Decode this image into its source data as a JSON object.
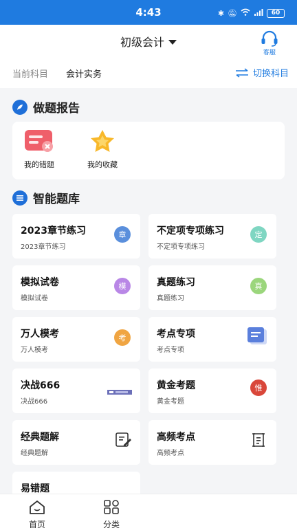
{
  "status_bar": {
    "time": "4:43",
    "battery": "60"
  },
  "header": {
    "subject": "初级会计",
    "service_label": "客服",
    "current_label": "当前科目",
    "current_value": "会计实务",
    "switch_label": "切换科目"
  },
  "report": {
    "title": "做题报告",
    "items": [
      {
        "label": "我的错题"
      },
      {
        "label": "我的收藏"
      }
    ]
  },
  "bank": {
    "title": "智能题库",
    "cards": [
      {
        "title": "2023章节练习",
        "sub": "2023章节练习",
        "badge": "章",
        "badge_color": "#5a8fdc"
      },
      {
        "title": "不定项专项练习",
        "sub": "不定项专项练习",
        "badge": "定",
        "badge_color": "#7fd6c2"
      },
      {
        "title": "模拟试卷",
        "sub": "模拟试卷",
        "badge": "模",
        "badge_color": "#b987e6"
      },
      {
        "title": "真题练习",
        "sub": "真题练习",
        "badge": "真",
        "badge_color": "#9bd67c"
      },
      {
        "title": "万人模考",
        "sub": "万人模考",
        "badge": "考",
        "badge_color": "#f0a542"
      },
      {
        "title": "考点专项",
        "sub": "考点专项",
        "icon": "document-icon"
      },
      {
        "title": "决战666",
        "sub": "决战666",
        "icon": "banner-icon"
      },
      {
        "title": "黄金考题",
        "sub": "黄金考题",
        "badge": "惟",
        "badge_color": "#d9473a"
      },
      {
        "title": "经典题解",
        "sub": "经典题解",
        "icon": "edit-icon"
      },
      {
        "title": "高频考点",
        "sub": "高频考点",
        "icon": "scroll-icon"
      },
      {
        "title": "易错题",
        "sub": ""
      }
    ]
  },
  "nav": [
    {
      "label": "首页",
      "icon": "home-icon"
    },
    {
      "label": "分类",
      "icon": "category-icon"
    }
  ]
}
